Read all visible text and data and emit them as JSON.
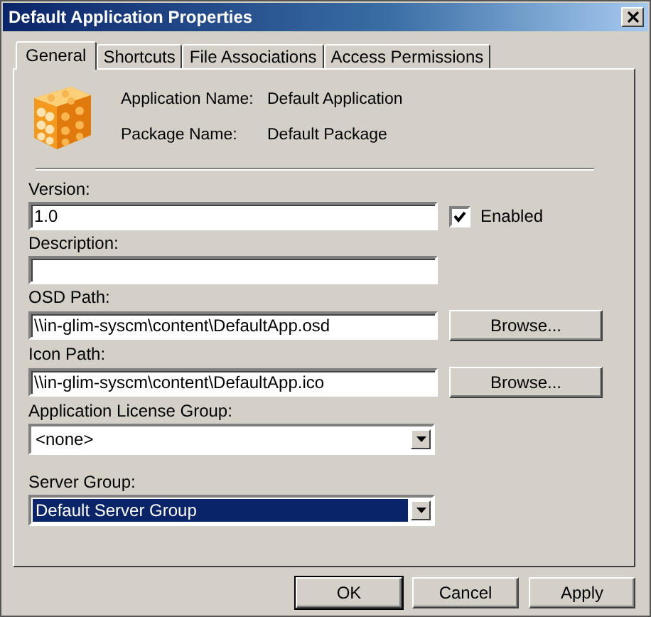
{
  "window": {
    "title": "Default Application Properties"
  },
  "tabs": [
    {
      "label": "General",
      "selected": true
    },
    {
      "label": "Shortcuts",
      "selected": false
    },
    {
      "label": "File Associations",
      "selected": false
    },
    {
      "label": "Access Permissions",
      "selected": false
    }
  ],
  "summary": [
    {
      "label": "Application Name:",
      "value": "Default Application"
    },
    {
      "label": "Package Name:",
      "value": "Default Package"
    }
  ],
  "fields": [
    {
      "kind": "text",
      "label": "Version:",
      "value": "1.0",
      "checkbox": {
        "label": "Enabled",
        "checked": true
      }
    },
    {
      "kind": "text",
      "label": "Description:"
    },
    {
      "kind": "browse",
      "label": "OSD Path:",
      "value": "\\\\in-glim-syscm\\content\\DefaultApp.osd",
      "button": "Browse..."
    },
    {
      "kind": "browse",
      "label": "Icon Path:",
      "value": "\\\\in-glim-syscm\\content\\DefaultApp.ico",
      "button": "Browse..."
    },
    {
      "kind": "combo",
      "label": "Application License Group:",
      "value": "<none>",
      "selected": false
    },
    {
      "kind": "combo",
      "label": "Server Group:",
      "value": "Default Server Group",
      "selected": true
    }
  ],
  "buttons": [
    {
      "label": "OK",
      "default": true
    },
    {
      "label": "Cancel",
      "default": false
    },
    {
      "label": "Apply",
      "default": false
    }
  ]
}
